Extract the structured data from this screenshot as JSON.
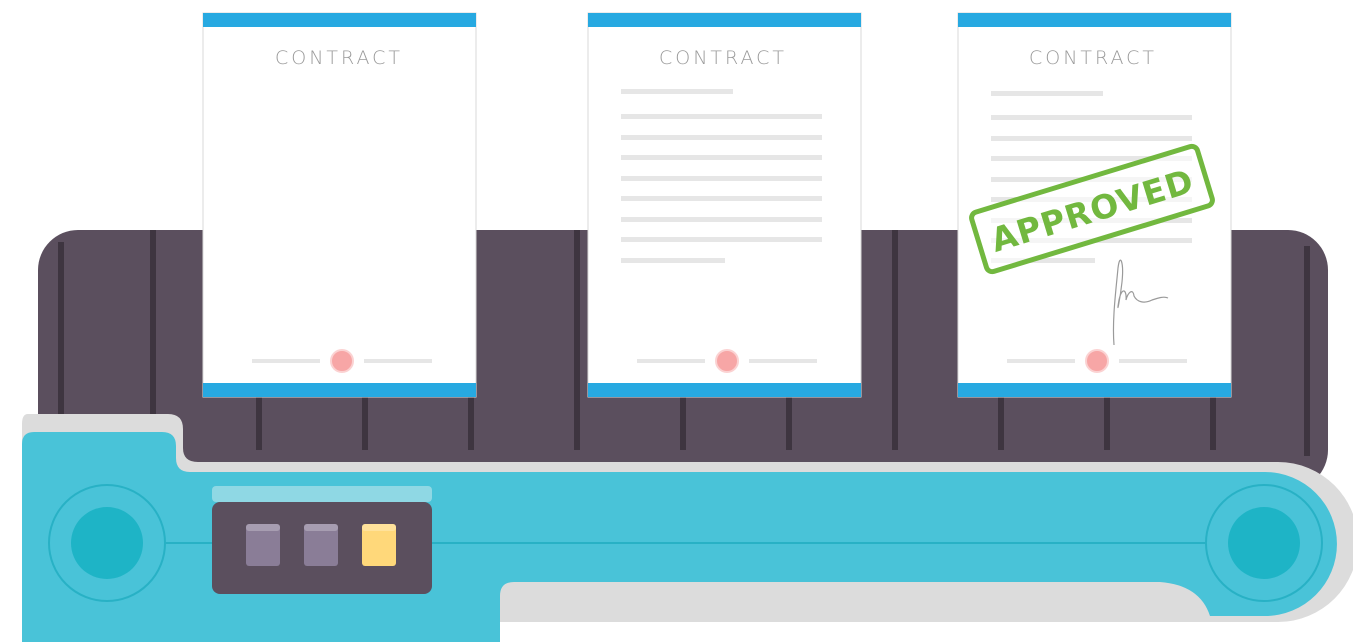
{
  "documents": [
    {
      "title": "CONTRACT",
      "state": "blank"
    },
    {
      "title": "CONTRACT",
      "state": "filled"
    },
    {
      "title": "CONTRACT",
      "state": "approved",
      "stamp": "APPROVED"
    }
  ],
  "panel": {
    "indicators": [
      {
        "name": "indicator-1",
        "color": "#8a7d97"
      },
      {
        "name": "indicator-2",
        "color": "#8a7d97"
      },
      {
        "name": "indicator-3",
        "color": "#ffd87a"
      }
    ]
  },
  "colors": {
    "belt": "#5b4f5e",
    "machine": "#49c3d8",
    "roller": "#1eb4c6",
    "doc_band": "#27a9e1",
    "seal": "#f7a6a6",
    "stamp": "#72b83f"
  }
}
